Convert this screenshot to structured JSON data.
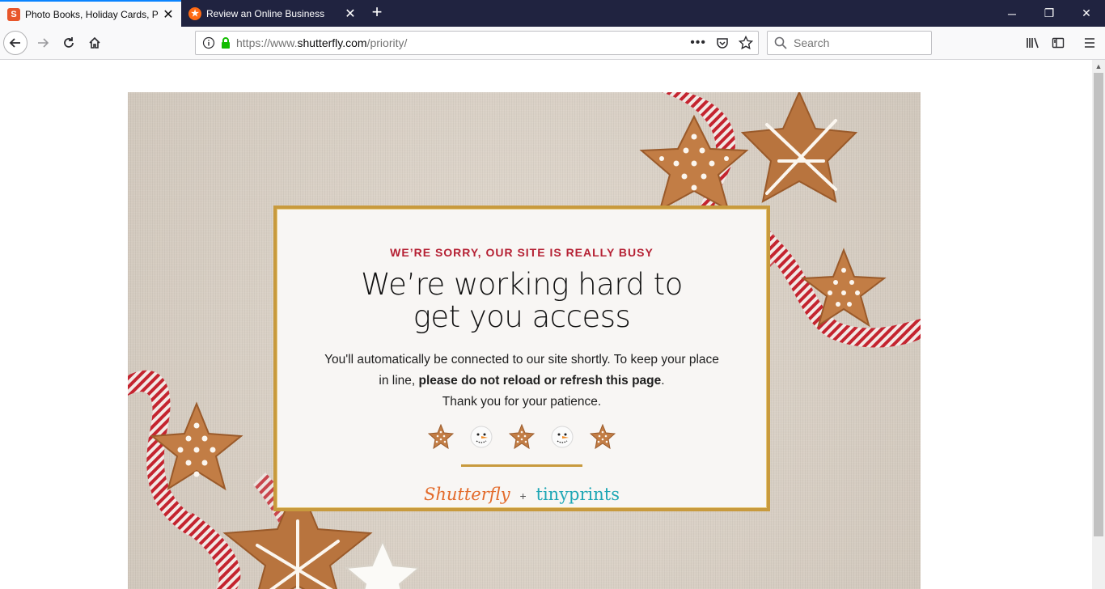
{
  "browser": {
    "tabs": [
      {
        "title": "Photo Books, Holiday Cards, Ph",
        "favicon": "shutterfly-s-icon",
        "active": true
      },
      {
        "title": "Review an Online Business",
        "favicon": "star-badge-icon",
        "active": false
      }
    ],
    "url_prefix": "https://www.",
    "url_domain": "shutterfly.com",
    "url_path": "/priority/",
    "search_placeholder": "Search"
  },
  "page": {
    "eyebrow": "WE’RE SORRY, OUR SITE IS REALLY BUSY",
    "headline_line1": "We’re working hard to",
    "headline_line2": "get you access",
    "body_part1": "You'll automatically be connected to our site shortly. To keep your place in line, ",
    "body_bold": "please do not reload or refresh this page",
    "body_part2": ".",
    "body_line3": "Thank you for your patience.",
    "icons": [
      "gingerbread-star-icon",
      "snowman-icon",
      "gingerbread-star-icon",
      "snowman-icon",
      "gingerbread-star-icon"
    ],
    "brand1": "Shutterfly",
    "brand_plus": "+",
    "brand2": "tinyprints",
    "colors": {
      "eyebrow": "#b52033",
      "frame_gold": "#c89a3d",
      "shutterfly_orange": "#e36b2b",
      "tinyprints_teal": "#1fa7b5",
      "linen_background": "#ddd3c7"
    }
  }
}
